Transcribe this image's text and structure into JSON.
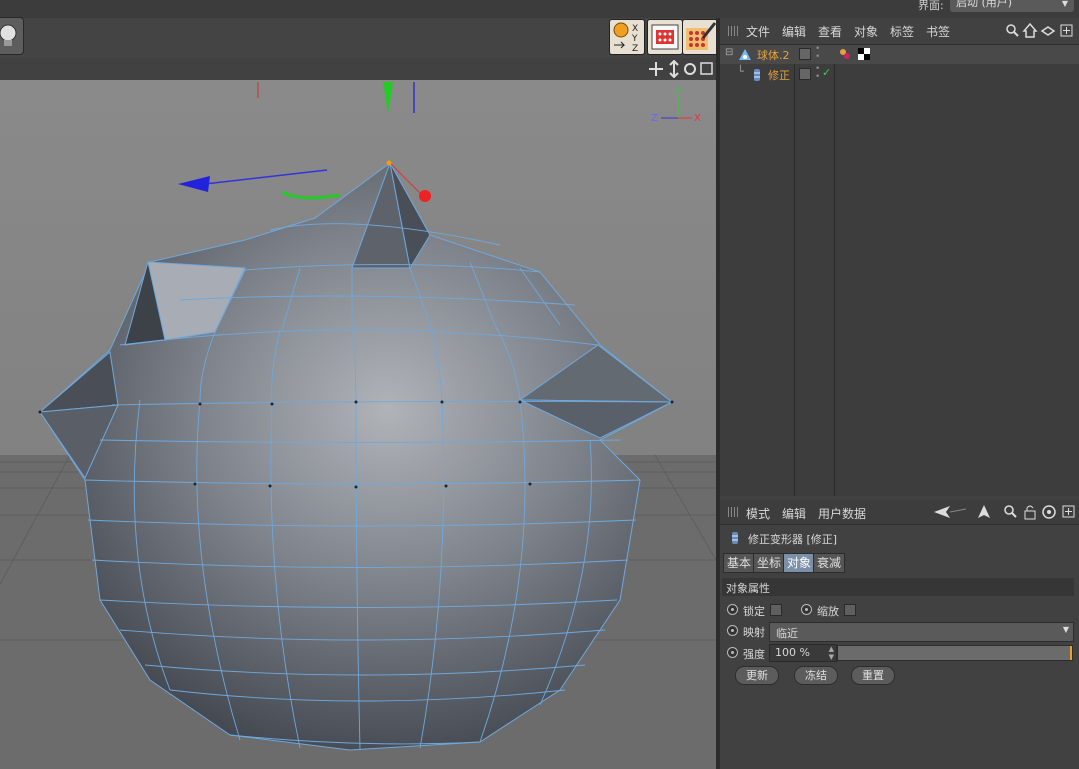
{
  "top": {
    "layout_label": "界面:",
    "layout_value": "启动 (用户)"
  },
  "viewport": {
    "axis": {
      "y": "Y",
      "z": "Z",
      "x": "X"
    }
  },
  "object_manager": {
    "menu": [
      "文件",
      "编辑",
      "查看",
      "对象",
      "标签",
      "书签"
    ],
    "objects": [
      {
        "name": "球体.2",
        "color": "#e6a23c"
      },
      {
        "name": "修正",
        "color": "#e6a23c"
      }
    ]
  },
  "attribute_manager": {
    "menu": [
      "模式",
      "编辑",
      "用户数据"
    ],
    "title": "修正变形器 [修正]",
    "tabs": [
      "基本",
      "坐标",
      "对象",
      "衰减"
    ],
    "active_tab": "对象",
    "section": "对象属性",
    "fields": {
      "lock": "锁定",
      "scale": "缩放",
      "mapping": "映射",
      "mapping_value": "临近",
      "strength": "强度",
      "strength_value": "100 %",
      "strength_fraction": 1.0
    },
    "buttons": [
      "更新",
      "冻结",
      "重置"
    ]
  },
  "colors": {
    "accent": "#e6a23c",
    "active_tab": "#7b8fa8",
    "mesh_wire": "#6fa8dc",
    "axis_x": "#e33",
    "axis_y": "#2c2",
    "axis_z": "#33d"
  }
}
